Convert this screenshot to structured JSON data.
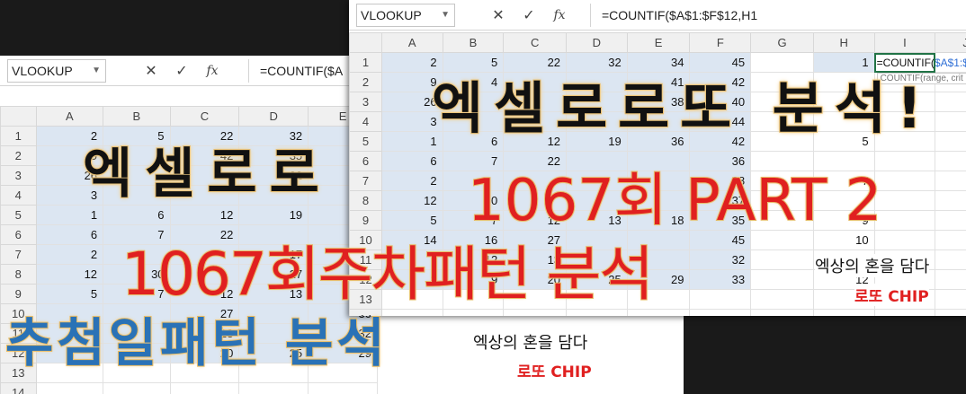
{
  "back": {
    "namebox": "VLOOKUP",
    "formula": "=COUNTIF($A",
    "columns": [
      "A",
      "B",
      "C",
      "D",
      "E"
    ],
    "rows": [
      [
        "2",
        "5",
        "22",
        "32",
        "34"
      ],
      [
        "9",
        "4",
        "42",
        "35",
        "41"
      ],
      [
        "26",
        "",
        "",
        "32",
        "38"
      ],
      [
        "3",
        "",
        "",
        "",
        "40"
      ],
      [
        "1",
        "6",
        "12",
        "19",
        "36"
      ],
      [
        "6",
        "7",
        "22",
        "",
        "42"
      ],
      [
        "2",
        "",
        "",
        "17",
        "24"
      ],
      [
        "12",
        "30",
        "",
        "27",
        "32"
      ],
      [
        "5",
        "7",
        "12",
        "13",
        "18"
      ],
      [
        "",
        "",
        "27",
        "",
        "30"
      ],
      [
        "",
        "",
        "13",
        "",
        "32"
      ],
      [
        "",
        "",
        "20",
        "25",
        "29"
      ]
    ]
  },
  "front": {
    "namebox": "VLOOKUP",
    "formula": "=COUNTIF($A$1:$F$12,H1",
    "columns": [
      "A",
      "B",
      "C",
      "D",
      "E",
      "F",
      "G",
      "H",
      "I",
      "J"
    ],
    "rows": [
      [
        "2",
        "5",
        "22",
        "32",
        "34",
        "45"
      ],
      [
        "9",
        "4",
        "",
        "",
        "41",
        "42"
      ],
      [
        "26",
        "",
        "",
        "",
        "38",
        "40"
      ],
      [
        "3",
        "",
        "",
        "",
        "",
        "44"
      ],
      [
        "1",
        "6",
        "12",
        "19",
        "36",
        "42"
      ],
      [
        "6",
        "7",
        "22",
        "",
        "",
        "36"
      ],
      [
        "2",
        "",
        "",
        "",
        "",
        "28"
      ],
      [
        "12",
        "30",
        "",
        "",
        "",
        "37"
      ],
      [
        "5",
        "7",
        "12",
        "13",
        "18",
        "35"
      ],
      [
        "14",
        "16",
        "27",
        "",
        "",
        "45"
      ],
      [
        "",
        "12",
        "13",
        "",
        "",
        "32"
      ],
      [
        "8",
        "9",
        "20",
        "25",
        "29",
        "33"
      ]
    ],
    "h_values": [
      "1",
      "",
      "",
      "",
      "5",
      "",
      "7",
      "",
      "9",
      "10",
      "",
      "12",
      "13"
    ],
    "edit_prefix": "=COUNTIF(",
    "edit_ref": "$A$1:$F$1",
    "tooltip": "COUNTIF(range, crit"
  },
  "overlays": {
    "title_front": "엑셀로로또 분석!",
    "part_front": "1067회 PART 2",
    "title_back": "엑셀로로",
    "pattern": "1067회주차패턴 분석",
    "draw_day": "추첨일패턴 분석",
    "sig_text": "엑상의 혼을 담다",
    "sig_chip": "로또 CHIP"
  }
}
